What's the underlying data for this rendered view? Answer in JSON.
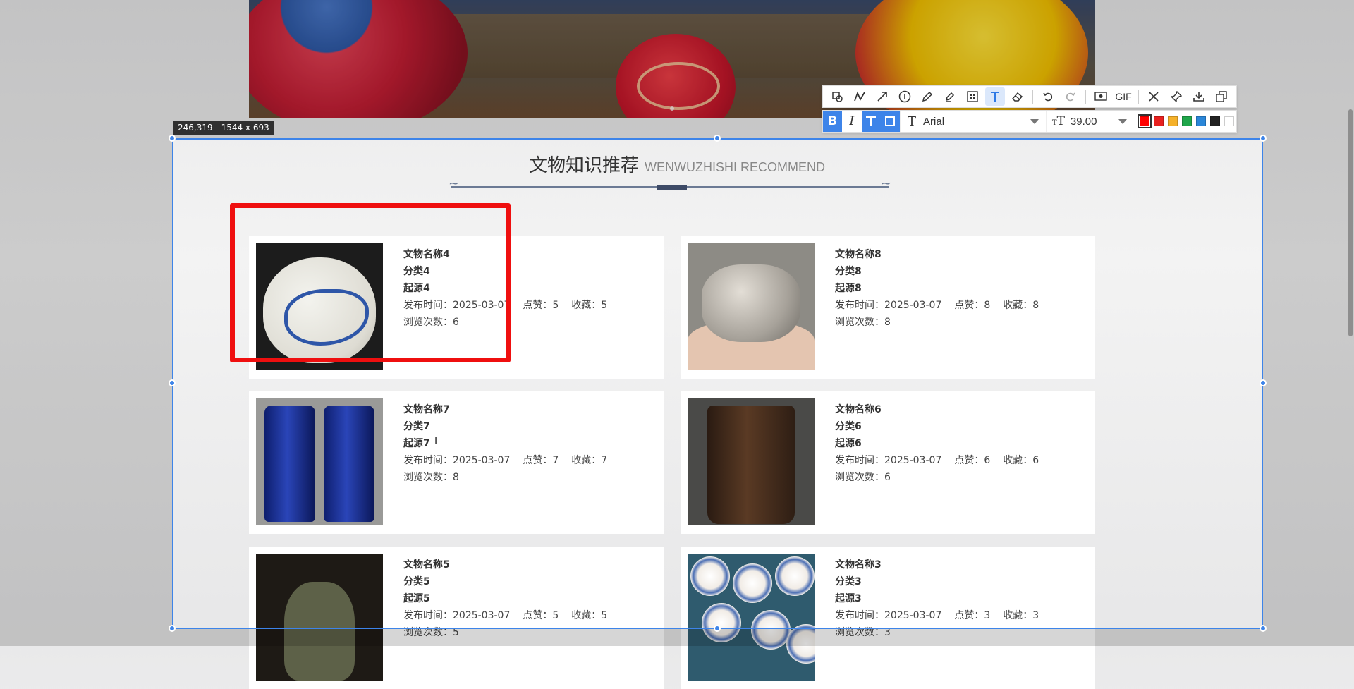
{
  "selection": {
    "label": "246,319 - 1544 x 693"
  },
  "section": {
    "title_cn": "文物知识推荐",
    "title_en": "WENWUZHISHI RECOMMEND"
  },
  "cards": [
    {
      "name": "文物名称4",
      "category": "分类4",
      "origin": "起源4",
      "publish": "发布时间：2025-03-07",
      "likes": "点赞：5",
      "favorites": "收藏：5",
      "views": "浏览次数：6",
      "image": "blue-white-porcelain-jar"
    },
    {
      "name": "文物名称8",
      "category": "分类8",
      "origin": "起源8",
      "publish": "发布时间：2025-03-07",
      "likes": "点赞：8",
      "favorites": "收藏：8",
      "views": "浏览次数：8",
      "image": "bronze-beast-in-hand"
    },
    {
      "name": "文物名称7",
      "category": "分类7",
      "origin": "起源7",
      "publish": "发布时间：2025-03-07",
      "likes": "点赞：7",
      "favorites": "收藏：7",
      "views": "浏览次数：8",
      "image": "blue-glaze-vases"
    },
    {
      "name": "文物名称6",
      "category": "分类6",
      "origin": "起源6",
      "publish": "发布时间：2025-03-07",
      "likes": "点赞：6",
      "favorites": "收藏：6",
      "views": "浏览次数：6",
      "image": "wooden-brush-pot"
    },
    {
      "name": "文物名称5",
      "category": "分类5",
      "origin": "起源5",
      "publish": "发布时间：2025-03-07",
      "likes": "点赞：5",
      "favorites": "收藏：5",
      "views": "浏览次数：5",
      "image": "bronze-bird-vessel"
    },
    {
      "name": "文物名称3",
      "category": "分类3",
      "origin": "起源3",
      "publish": "发布时间：2025-03-07",
      "likes": "点赞：3",
      "favorites": "收藏：3",
      "views": "浏览次数：3",
      "image": "porcelain-plates"
    }
  ],
  "toolbar": {
    "tools": [
      "rectangle-icon",
      "polyline-icon",
      "arrow-icon",
      "number-marker-icon",
      "pencil-icon",
      "highlighter-icon",
      "mosaic-icon",
      "text-icon",
      "eraser-icon",
      "undo-icon",
      "redo-icon",
      "screen-record-icon",
      "gif",
      "close-icon",
      "pin-icon",
      "download-icon",
      "copy-icon"
    ],
    "gif_label": "GIF",
    "active_tool": "text-icon"
  },
  "text_format": {
    "font": "Arial",
    "size": "39.00",
    "colors": [
      "#ff0000",
      "#e8211f",
      "#f5b12a",
      "#1fa64a",
      "#2a86d8",
      "#222222",
      "#ffffff"
    ],
    "selected_color": "#ff0000"
  },
  "accent": "#3d84e9",
  "annotation_color": "#ef0f0f"
}
